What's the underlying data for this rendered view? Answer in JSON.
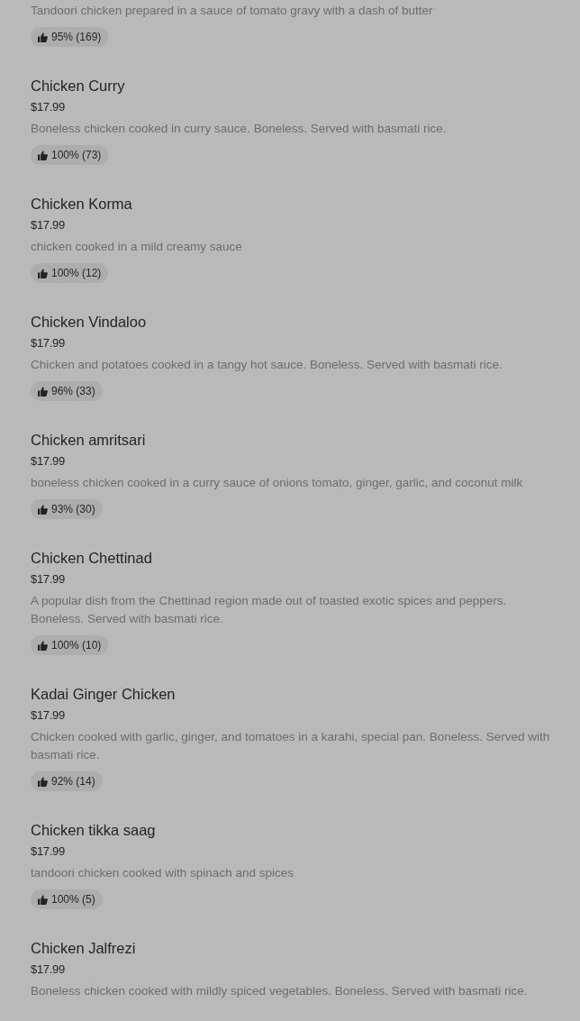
{
  "menu_items": [
    {
      "description": "Tandoori chicken prepared in a sauce of tomato gravy with a dash of butter",
      "rating": "95% (169)"
    },
    {
      "name": "Chicken Curry",
      "price": "$17.99",
      "description": "Boneless chicken cooked in curry sauce. Boneless. Served with basmati rice.",
      "rating": "100% (73)"
    },
    {
      "name": "Chicken Korma",
      "price": "$17.99",
      "description": "chicken cooked in a mild creamy sauce",
      "rating": "100% (12)"
    },
    {
      "name": "Chicken Vindaloo",
      "price": "$17.99",
      "description": "Chicken and potatoes cooked in a tangy hot sauce. Boneless. Served with basmati rice.",
      "rating": "96% (33)"
    },
    {
      "name": "Chicken amritsari",
      "price": "$17.99",
      "description": "boneless chicken cooked in a curry sauce of onions tomato, ginger, garlic, and coconut milk",
      "rating": "93% (30)"
    },
    {
      "name": "Chicken Chettinad",
      "price": "$17.99",
      "description": "A popular dish from the Chettinad region made out of toasted exotic spices and peppers. Boneless. Served with basmati rice.",
      "rating": "100% (10)"
    },
    {
      "name": "Kadai Ginger Chicken",
      "price": "$17.99",
      "description": "Chicken cooked with garlic, ginger, and tomatoes in a karahi, special pan. Boneless. Served with basmati rice.",
      "rating": "92% (14)"
    },
    {
      "name": "Chicken tikka saag",
      "price": "$17.99",
      "description": "tandoori chicken cooked with spinach and spices",
      "rating": "100% (5)"
    },
    {
      "name": "Chicken Jalfrezi",
      "price": "$17.99",
      "description": "Boneless chicken cooked with mildly spiced vegetables. Boneless. Served with basmati rice."
    }
  ]
}
